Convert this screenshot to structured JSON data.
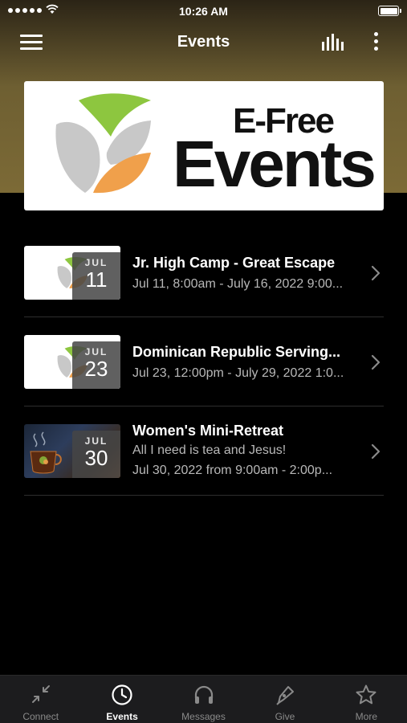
{
  "status_bar": {
    "time": "10:26 AM"
  },
  "nav": {
    "title": "Events"
  },
  "banner": {
    "line1": "E-Free",
    "line2": "Events"
  },
  "events": [
    {
      "month": "JUL",
      "day": "11",
      "title": "Jr. High Camp - Great Escape",
      "subtitle": "",
      "dates": "Jul 11, 8:00am - July 16, 2022 9:00..."
    },
    {
      "month": "JUL",
      "day": "23",
      "title": "Dominican Republic Serving...",
      "subtitle": "",
      "dates": "Jul 23, 12:00pm - July 29, 2022 1:0..."
    },
    {
      "month": "JUL",
      "day": "30",
      "title": "Women's Mini-Retreat",
      "subtitle": "All I need is tea and Jesus!",
      "dates": "Jul 30, 2022 from 9:00am - 2:00p..."
    }
  ],
  "tabs": [
    {
      "label": "Connect",
      "icon": "connect-arrows-icon",
      "active": false
    },
    {
      "label": "Events",
      "icon": "clock-icon",
      "active": true
    },
    {
      "label": "Messages",
      "icon": "headphones-icon",
      "active": false
    },
    {
      "label": "Give",
      "icon": "pen-icon",
      "active": false
    },
    {
      "label": "More",
      "icon": "star-icon",
      "active": false
    }
  ],
  "colors": {
    "header_gold": "#7c6a36",
    "logo_green": "#8dc63f",
    "logo_orange": "#f0a04b",
    "logo_gray": "#c8c8c8"
  }
}
